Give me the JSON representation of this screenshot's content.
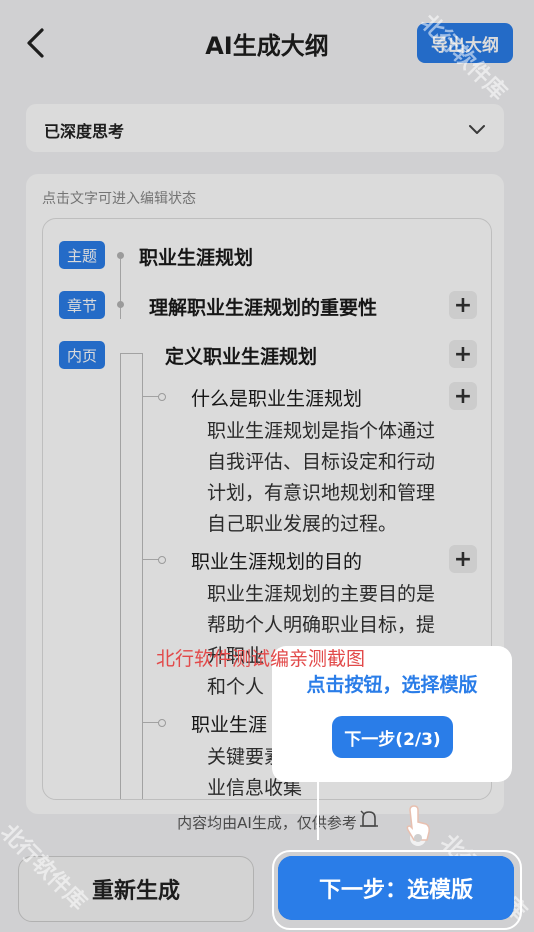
{
  "header": {
    "title": "AI生成大纲",
    "export_label": "导出大纲"
  },
  "thinking": {
    "label": "已深度思考"
  },
  "panel": {
    "hint": "点击文字可进入编辑状态"
  },
  "tags": {
    "theme": "主题",
    "chapter": "章节",
    "page": "内页"
  },
  "outline": {
    "theme": "职业生涯规划",
    "chapter": "理解职业生涯规划的重要性",
    "page": "定义职业生涯规划",
    "items": [
      {
        "title": "什么是职业生涯规划",
        "body": [
          "职业生涯规划是指个体通过",
          "自我评估、目标设定和行动",
          "计划，有意识地规划和管理",
          "自己职业发展的过程。"
        ]
      },
      {
        "title": "职业生涯规划的目的",
        "body": [
          "职业生涯规划的主要目的是",
          "帮助个人明确职业目标，提",
          "升职业",
          "和个人"
        ]
      },
      {
        "title": "职业生涯",
        "body": [
          "关键要素",
          "业信息收集"
        ]
      }
    ]
  },
  "footer": {
    "note": "内容均由AI生成，仅供参考",
    "regenerate": "重新生成",
    "next": "下一步：选模版"
  },
  "tooltip": {
    "text": "点击按钮，选择模版",
    "button": "下一步(2/3)"
  },
  "watermark": {
    "text": "北行软件测试编亲测截图",
    "diag": "北行软件库"
  },
  "colors": {
    "accent": "#2a7de8",
    "watermark": "#e24a4a"
  },
  "icons": {
    "back": "chevron-left-icon",
    "expand": "chevron-down-icon",
    "add": "plus-icon",
    "bell": "bell-icon",
    "hand": "pointer-hand-icon"
  }
}
